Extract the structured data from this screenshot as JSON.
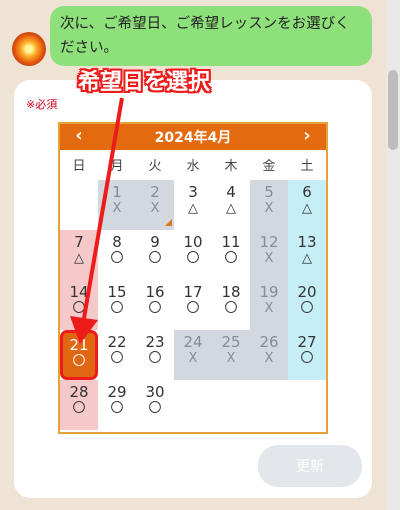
{
  "chat": {
    "message": "次に、ご希望日、ご希望レッスンをお選びください。"
  },
  "form": {
    "required_label": "※必須",
    "update_label": "更新"
  },
  "annotation": {
    "text": "希望日を選択"
  },
  "calendar": {
    "title": "2024年4月",
    "prev_icon": "‹",
    "next_icon": "›",
    "weekdays": [
      "日",
      "月",
      "火",
      "水",
      "木",
      "金",
      "土"
    ],
    "days": [
      {
        "d": "1",
        "m": "X",
        "col": 1,
        "row": 0,
        "s": "gray"
      },
      {
        "d": "2",
        "m": "X",
        "col": 2,
        "row": 0,
        "s": "gray",
        "corner": true
      },
      {
        "d": "3",
        "m": "△",
        "col": 3,
        "row": 0,
        "s": ""
      },
      {
        "d": "4",
        "m": "△",
        "col": 4,
        "row": 0,
        "s": ""
      },
      {
        "d": "5",
        "m": "X",
        "col": 5,
        "row": 0,
        "s": "gray"
      },
      {
        "d": "6",
        "m": "△",
        "col": 6,
        "row": 0,
        "s": "sat"
      },
      {
        "d": "7",
        "m": "△",
        "col": 0,
        "row": 1,
        "s": "sun"
      },
      {
        "d": "8",
        "m": "〇",
        "col": 1,
        "row": 1,
        "s": ""
      },
      {
        "d": "9",
        "m": "〇",
        "col": 2,
        "row": 1,
        "s": ""
      },
      {
        "d": "10",
        "m": "〇",
        "col": 3,
        "row": 1,
        "s": ""
      },
      {
        "d": "11",
        "m": "〇",
        "col": 4,
        "row": 1,
        "s": ""
      },
      {
        "d": "12",
        "m": "X",
        "col": 5,
        "row": 1,
        "s": "gray"
      },
      {
        "d": "13",
        "m": "△",
        "col": 6,
        "row": 1,
        "s": "sat"
      },
      {
        "d": "14",
        "m": "〇",
        "col": 0,
        "row": 2,
        "s": "sun"
      },
      {
        "d": "15",
        "m": "〇",
        "col": 1,
        "row": 2,
        "s": ""
      },
      {
        "d": "16",
        "m": "〇",
        "col": 2,
        "row": 2,
        "s": ""
      },
      {
        "d": "17",
        "m": "〇",
        "col": 3,
        "row": 2,
        "s": ""
      },
      {
        "d": "18",
        "m": "〇",
        "col": 4,
        "row": 2,
        "s": ""
      },
      {
        "d": "19",
        "m": "X",
        "col": 5,
        "row": 2,
        "s": "gray"
      },
      {
        "d": "20",
        "m": "〇",
        "col": 6,
        "row": 2,
        "s": "sat"
      },
      {
        "d": "21",
        "m": "〇",
        "col": 0,
        "row": 3,
        "s": "sel"
      },
      {
        "d": "22",
        "m": "〇",
        "col": 1,
        "row": 3,
        "s": ""
      },
      {
        "d": "23",
        "m": "〇",
        "col": 2,
        "row": 3,
        "s": ""
      },
      {
        "d": "24",
        "m": "X",
        "col": 3,
        "row": 3,
        "s": "gray"
      },
      {
        "d": "25",
        "m": "X",
        "col": 4,
        "row": 3,
        "s": "gray"
      },
      {
        "d": "26",
        "m": "X",
        "col": 5,
        "row": 3,
        "s": "gray"
      },
      {
        "d": "27",
        "m": "〇",
        "col": 6,
        "row": 3,
        "s": "sat"
      },
      {
        "d": "28",
        "m": "〇",
        "col": 0,
        "row": 4,
        "s": "sun"
      },
      {
        "d": "29",
        "m": "〇",
        "col": 1,
        "row": 4,
        "s": ""
      },
      {
        "d": "30",
        "m": "〇",
        "col": 2,
        "row": 4,
        "s": ""
      }
    ]
  },
  "colors": {
    "accent": "#e46a10",
    "chat_bubble": "#8ee07a",
    "highlight": "#ee1b1b"
  }
}
